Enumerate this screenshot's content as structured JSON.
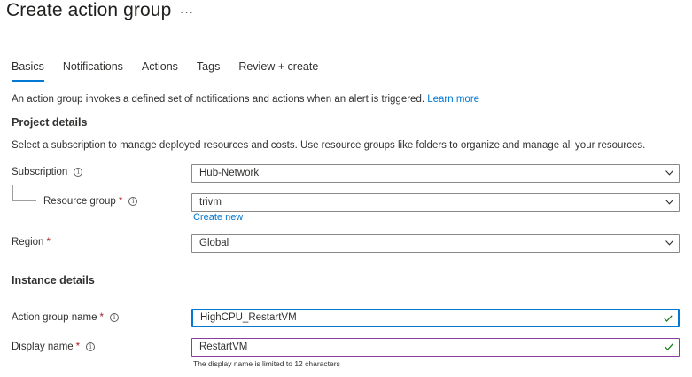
{
  "header": {
    "title": "Create action group",
    "more": "···"
  },
  "tabs": [
    {
      "label": "Basics",
      "active": true
    },
    {
      "label": "Notifications",
      "active": false
    },
    {
      "label": "Actions",
      "active": false
    },
    {
      "label": "Tags",
      "active": false
    },
    {
      "label": "Review + create",
      "active": false
    }
  ],
  "intro": {
    "text": "An action group invokes a defined set of notifications and actions when an alert is triggered.",
    "link": "Learn more"
  },
  "project": {
    "heading": "Project details",
    "description": "Select a subscription to manage deployed resources and costs. Use resource groups like folders to organize and manage all your resources.",
    "subscription_label": "Subscription",
    "subscription_value": "Hub-Network",
    "resource_group_label": "Resource group",
    "resource_group_value": "trivm",
    "create_new": "Create new",
    "region_label": "Region",
    "region_value": "Global"
  },
  "instance": {
    "heading": "Instance details",
    "action_group_name_label": "Action group name",
    "action_group_name_value": "HighCPU_RestartVM",
    "display_name_label": "Display name",
    "display_name_value": "RestartVM",
    "display_name_hint": "The display name is limited to 12 characters"
  },
  "colors": {
    "accent": "#0078d4",
    "required": "#a4262c",
    "valid": "#107c10",
    "display_border": "#8a3b9e"
  },
  "icons": {
    "info": "info-icon",
    "dropdown": "chevron-down-icon",
    "valid": "checkmark-icon"
  }
}
